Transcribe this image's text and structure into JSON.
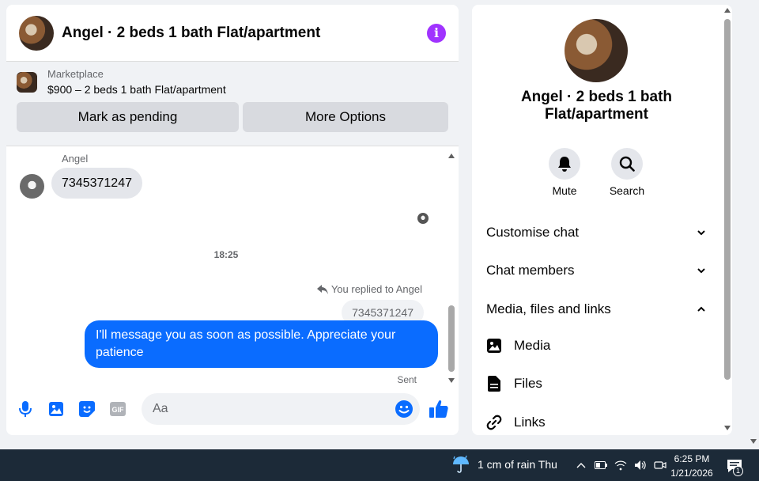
{
  "chat": {
    "title": "Angel · 2 beds 1 bath Flat/apartment"
  },
  "marketplace": {
    "label": "Marketplace",
    "listing": "$900 – 2 beds 1 bath Flat/apartment",
    "pending_label": "Mark as pending",
    "more_label": "More Options"
  },
  "messages": {
    "sender": "Angel",
    "incoming_text": "7345371247",
    "timestamp": "18:25",
    "reply_note": "You replied to Angel",
    "reply_quote": "7345371247",
    "outgoing_text": "I'll message you as soon as possible. Appreciate your patience",
    "status": "Sent"
  },
  "composer": {
    "placeholder": "Aa"
  },
  "info": {
    "title": "Angel · 2 beds 1 bath Flat/apartment",
    "mute_label": "Mute",
    "search_label": "Search",
    "sections": {
      "customise": "Customise chat",
      "members": "Chat members",
      "media_files": "Media, files and links"
    },
    "items": {
      "media": "Media",
      "files": "Files",
      "links": "Links"
    }
  },
  "taskbar": {
    "weather": "1 cm of rain Thu",
    "time": "6:25 PM",
    "date": "1/21/2026",
    "notification_count": "1"
  },
  "colors": {
    "accent": "#0a6cff",
    "info_purple": "#a033ff",
    "taskbar": "#1c2a38"
  }
}
